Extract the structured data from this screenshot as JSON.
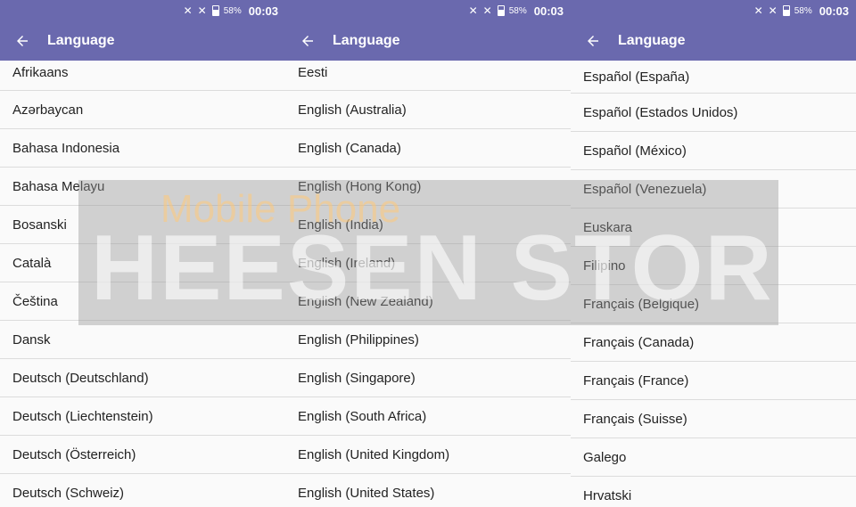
{
  "status_bar": {
    "signal_icon_1": "no-signal-icon",
    "signal_icon_2": "no-signal-icon",
    "battery_percent": "58%",
    "time": "00:03"
  },
  "toolbar": {
    "title": "Language",
    "back_icon": "arrow-left-icon"
  },
  "colors": {
    "toolbar_bg": "#6a69ae",
    "list_bg": "#fafafa",
    "divider": "#dcdcdc"
  },
  "screens": [
    {
      "items": [
        "Afrikaans",
        "Azərbaycan",
        "Bahasa Indonesia",
        "Bahasa Melayu",
        "Bosanski",
        "Català",
        "Čeština",
        "Dansk",
        "Deutsch (Deutschland)",
        "Deutsch (Liechtenstein)",
        "Deutsch (Österreich)",
        "Deutsch (Schweiz)"
      ]
    },
    {
      "items": [
        "Eesti",
        "English (Australia)",
        "English (Canada)",
        "English (Hong Kong)",
        "English (India)",
        "English (Ireland)",
        "English (New Zealand)",
        "English (Philippines)",
        "English (Singapore)",
        "English (South Africa)",
        "English (United Kingdom)",
        "English (United States)"
      ]
    },
    {
      "items": [
        "Español (España)",
        "Español (Estados Unidos)",
        "Español (México)",
        "Español (Venezuela)",
        "Euskara",
        "Filipino",
        "Français (Belgique)",
        "Français (Canada)",
        "Français (France)",
        "Français (Suisse)",
        "Galego",
        "Hrvatski"
      ]
    }
  ],
  "watermark": {
    "line1": "Mobile Phone",
    "line2": "HEESEN STORE"
  }
}
